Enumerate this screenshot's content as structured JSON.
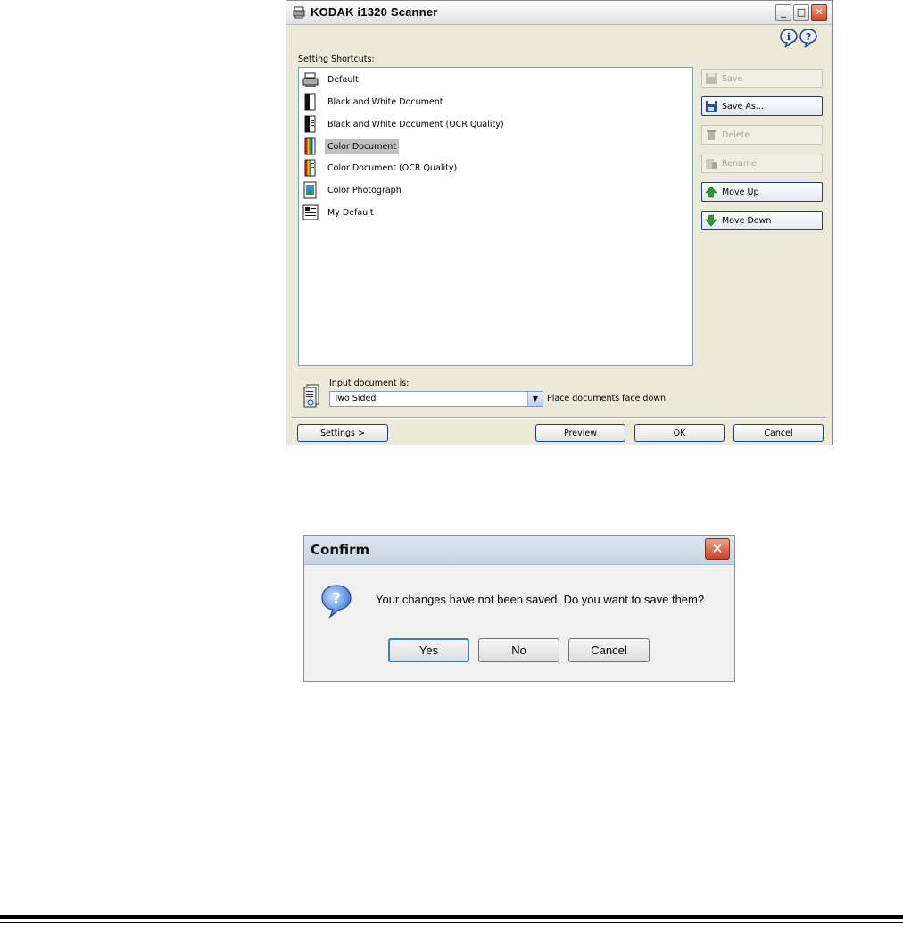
{
  "scanner": {
    "title": "KODAK i1320 Scanner",
    "shortcuts_label": "Setting Shortcuts:",
    "shortcuts": [
      {
        "label": "Default",
        "icon": "scanner-icon"
      },
      {
        "label": "Black and White Document",
        "icon": "bw-document-icon"
      },
      {
        "label": "Black and White Document (OCR Quality)",
        "icon": "bw-ocr-document-icon"
      },
      {
        "label": "Color Document",
        "icon": "color-document-icon",
        "selected": true
      },
      {
        "label": "Color Document (OCR Quality)",
        "icon": "color-ocr-document-icon"
      },
      {
        "label": "Color Photograph",
        "icon": "color-photograph-icon"
      },
      {
        "label": "My Default",
        "icon": "custom-document-icon"
      }
    ],
    "buttons": {
      "save": "Save",
      "save_as": "Save As...",
      "delete": "Delete",
      "rename": "Rename",
      "move_up": "Move Up",
      "move_down": "Move Down"
    },
    "input_label": "Input document is:",
    "input_value": "Two Sided",
    "placement_note": "Place documents face down",
    "bottom_buttons": {
      "settings": "Settings >",
      "preview": "Preview",
      "ok": "OK",
      "cancel": "Cancel"
    }
  },
  "confirm": {
    "title": "Confirm",
    "message": "Your changes have not been saved.  Do you want to save them?",
    "yes": "Yes",
    "no": "No",
    "cancel": "Cancel"
  }
}
